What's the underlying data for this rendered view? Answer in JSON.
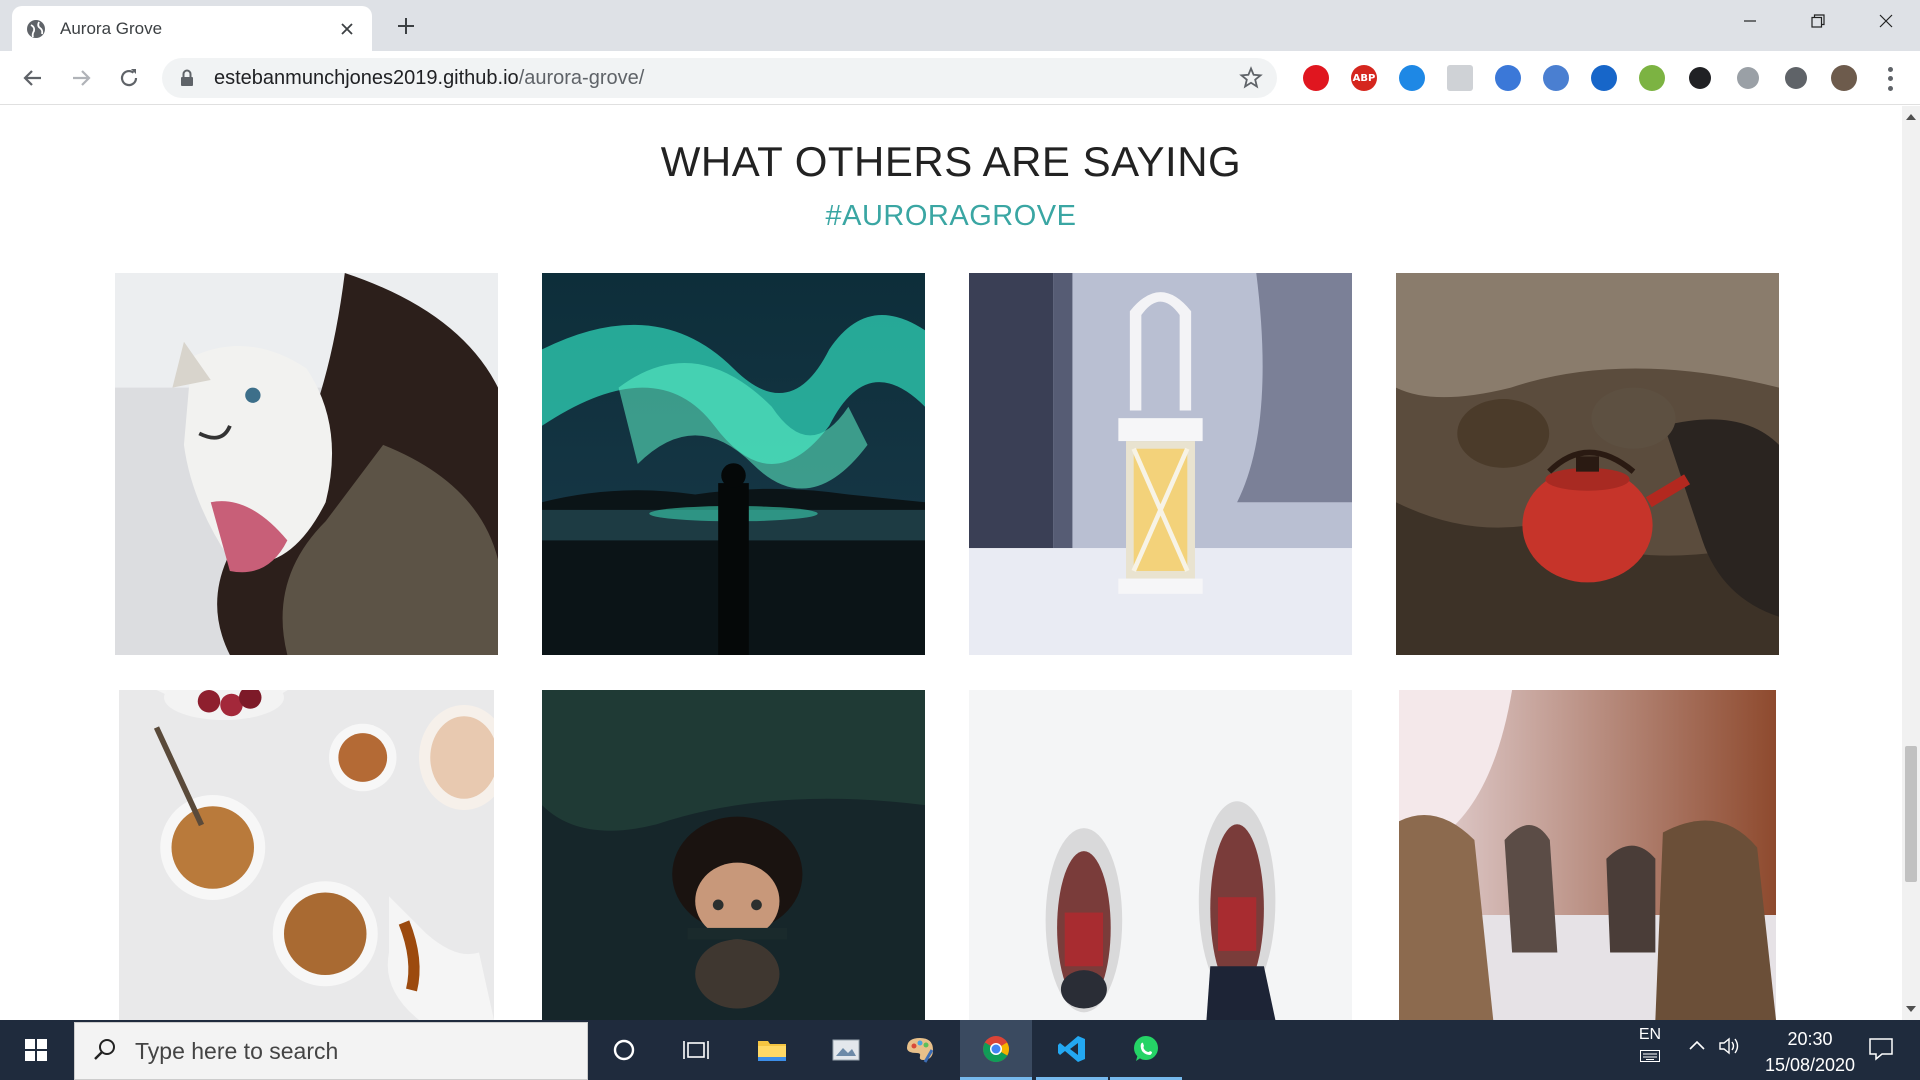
{
  "browser": {
    "tab_title": "Aurora Grove",
    "url_host": "estebanmunchjones2019.github.io",
    "url_path": "/aurora-grove/",
    "extensions": [
      {
        "name": "ublock-icon",
        "label": "",
        "color": "#e0161f"
      },
      {
        "name": "adblock-plus-icon",
        "label": "ABP",
        "color": "#d5261e"
      },
      {
        "name": "screen-capture-icon",
        "label": "",
        "color": "#1e88e5"
      },
      {
        "name": "blank-extension-icon",
        "label": "",
        "color": "#cfd2d6"
      },
      {
        "name": "globe-extension-icon",
        "label": "",
        "color": "#3b78d8"
      },
      {
        "name": "calendar-extension-icon",
        "label": "",
        "color": "#4a7fd1"
      },
      {
        "name": "crop-extension-icon",
        "label": "",
        "color": "#1766c9"
      },
      {
        "name": "pin-extension-icon",
        "label": "",
        "color": "#7cb342"
      },
      {
        "name": "dark-mode-icon",
        "label": "",
        "color": "#202124"
      },
      {
        "name": "camera-extension-icon",
        "label": "",
        "color": "#9aa0a6"
      },
      {
        "name": "puzzle-icon",
        "label": "",
        "color": "#5f6368"
      },
      {
        "name": "profile-avatar-icon",
        "label": "",
        "color": "#6d5b4c"
      }
    ]
  },
  "page": {
    "section_title": "WHAT OTHERS ARE SAYING",
    "section_tag": "#AURORAGROVE",
    "photos": [
      {
        "name": "photo-husky-puppy",
        "desc": "husky puppy held in arms"
      },
      {
        "name": "photo-northern-lights",
        "desc": "aurora over lake with silhouette"
      },
      {
        "name": "photo-snow-lantern",
        "desc": "frosted lantern in snow"
      },
      {
        "name": "photo-kettles-campfire",
        "desc": "kettles on campfire"
      },
      {
        "name": "photo-oatmeal-bowls",
        "desc": "oatmeal bowls on marble"
      },
      {
        "name": "photo-swimmer-lake",
        "desc": "face emerging from water"
      },
      {
        "name": "photo-snowshoes",
        "desc": "snowshoes in snow"
      },
      {
        "name": "photo-sled-dogs",
        "desc": "sled dogs in snowy forest"
      }
    ]
  },
  "taskbar": {
    "search_placeholder": "Type here to search",
    "language": "EN",
    "time": "20:30",
    "date": "15/08/2020"
  }
}
